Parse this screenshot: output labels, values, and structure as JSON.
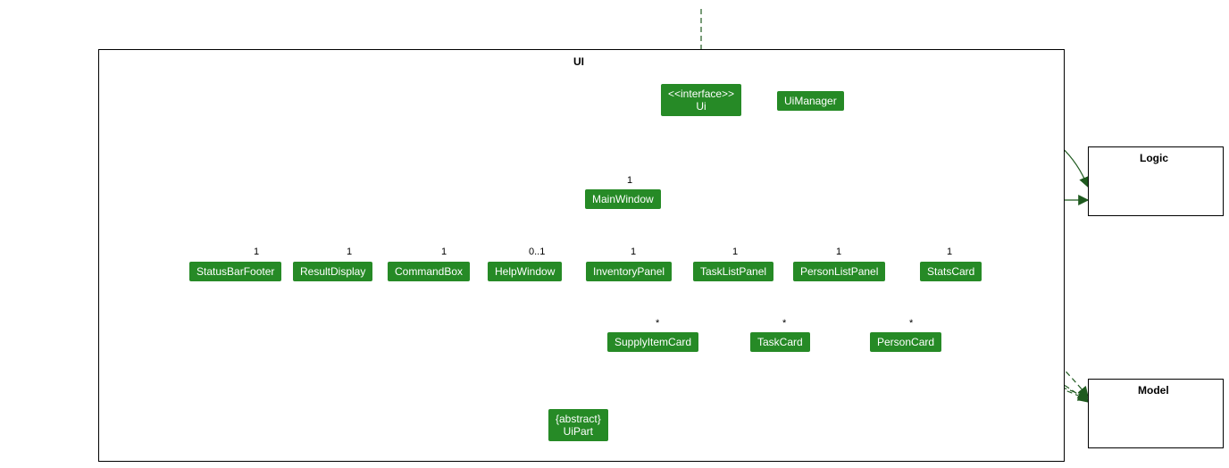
{
  "package": {
    "label": "UI"
  },
  "external": {
    "logic": "Logic",
    "model": "Model"
  },
  "nodes": {
    "uiInterface": {
      "stereotype": "<<interface>>",
      "name": "Ui"
    },
    "uiManager": "UiManager",
    "mainWindow": "MainWindow",
    "statusBarFooter": "StatusBarFooter",
    "resultDisplay": "ResultDisplay",
    "commandBox": "CommandBox",
    "helpWindow": "HelpWindow",
    "inventoryPanel": "InventoryPanel",
    "taskListPanel": "TaskListPanel",
    "personListPanel": "PersonListPanel",
    "statsCard": "StatsCard",
    "supplyItemCard": "SupplyItemCard",
    "taskCard": "TaskCard",
    "personCard": "PersonCard",
    "uiPart": {
      "stereotype": "{abstract}",
      "name": "UiPart"
    }
  },
  "mults": {
    "mainWindow": "1",
    "statusBarFooter": "1",
    "resultDisplay": "1",
    "commandBox": "1",
    "helpWindow": "0..1",
    "inventoryPanel": "1",
    "taskListPanel": "1",
    "personListPanel": "1",
    "statsCard": "1",
    "supplyItemCard": "*",
    "taskCard": "*",
    "personCard": "*"
  },
  "colors": {
    "nodeFill": "#268a26",
    "edge": "#1f5a1f"
  }
}
